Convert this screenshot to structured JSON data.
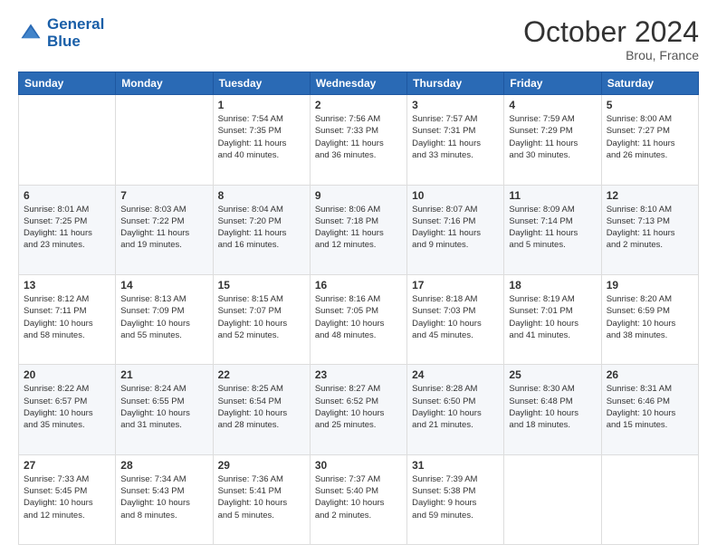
{
  "header": {
    "logo_line1": "General",
    "logo_line2": "Blue",
    "title": "October 2024",
    "location": "Brou, France"
  },
  "weekdays": [
    "Sunday",
    "Monday",
    "Tuesday",
    "Wednesday",
    "Thursday",
    "Friday",
    "Saturday"
  ],
  "weeks": [
    [
      {
        "day": "",
        "info": ""
      },
      {
        "day": "",
        "info": ""
      },
      {
        "day": "1",
        "info": "Sunrise: 7:54 AM\nSunset: 7:35 PM\nDaylight: 11 hours\nand 40 minutes."
      },
      {
        "day": "2",
        "info": "Sunrise: 7:56 AM\nSunset: 7:33 PM\nDaylight: 11 hours\nand 36 minutes."
      },
      {
        "day": "3",
        "info": "Sunrise: 7:57 AM\nSunset: 7:31 PM\nDaylight: 11 hours\nand 33 minutes."
      },
      {
        "day": "4",
        "info": "Sunrise: 7:59 AM\nSunset: 7:29 PM\nDaylight: 11 hours\nand 30 minutes."
      },
      {
        "day": "5",
        "info": "Sunrise: 8:00 AM\nSunset: 7:27 PM\nDaylight: 11 hours\nand 26 minutes."
      }
    ],
    [
      {
        "day": "6",
        "info": "Sunrise: 8:01 AM\nSunset: 7:25 PM\nDaylight: 11 hours\nand 23 minutes."
      },
      {
        "day": "7",
        "info": "Sunrise: 8:03 AM\nSunset: 7:22 PM\nDaylight: 11 hours\nand 19 minutes."
      },
      {
        "day": "8",
        "info": "Sunrise: 8:04 AM\nSunset: 7:20 PM\nDaylight: 11 hours\nand 16 minutes."
      },
      {
        "day": "9",
        "info": "Sunrise: 8:06 AM\nSunset: 7:18 PM\nDaylight: 11 hours\nand 12 minutes."
      },
      {
        "day": "10",
        "info": "Sunrise: 8:07 AM\nSunset: 7:16 PM\nDaylight: 11 hours\nand 9 minutes."
      },
      {
        "day": "11",
        "info": "Sunrise: 8:09 AM\nSunset: 7:14 PM\nDaylight: 11 hours\nand 5 minutes."
      },
      {
        "day": "12",
        "info": "Sunrise: 8:10 AM\nSunset: 7:13 PM\nDaylight: 11 hours\nand 2 minutes."
      }
    ],
    [
      {
        "day": "13",
        "info": "Sunrise: 8:12 AM\nSunset: 7:11 PM\nDaylight: 10 hours\nand 58 minutes."
      },
      {
        "day": "14",
        "info": "Sunrise: 8:13 AM\nSunset: 7:09 PM\nDaylight: 10 hours\nand 55 minutes."
      },
      {
        "day": "15",
        "info": "Sunrise: 8:15 AM\nSunset: 7:07 PM\nDaylight: 10 hours\nand 52 minutes."
      },
      {
        "day": "16",
        "info": "Sunrise: 8:16 AM\nSunset: 7:05 PM\nDaylight: 10 hours\nand 48 minutes."
      },
      {
        "day": "17",
        "info": "Sunrise: 8:18 AM\nSunset: 7:03 PM\nDaylight: 10 hours\nand 45 minutes."
      },
      {
        "day": "18",
        "info": "Sunrise: 8:19 AM\nSunset: 7:01 PM\nDaylight: 10 hours\nand 41 minutes."
      },
      {
        "day": "19",
        "info": "Sunrise: 8:20 AM\nSunset: 6:59 PM\nDaylight: 10 hours\nand 38 minutes."
      }
    ],
    [
      {
        "day": "20",
        "info": "Sunrise: 8:22 AM\nSunset: 6:57 PM\nDaylight: 10 hours\nand 35 minutes."
      },
      {
        "day": "21",
        "info": "Sunrise: 8:24 AM\nSunset: 6:55 PM\nDaylight: 10 hours\nand 31 minutes."
      },
      {
        "day": "22",
        "info": "Sunrise: 8:25 AM\nSunset: 6:54 PM\nDaylight: 10 hours\nand 28 minutes."
      },
      {
        "day": "23",
        "info": "Sunrise: 8:27 AM\nSunset: 6:52 PM\nDaylight: 10 hours\nand 25 minutes."
      },
      {
        "day": "24",
        "info": "Sunrise: 8:28 AM\nSunset: 6:50 PM\nDaylight: 10 hours\nand 21 minutes."
      },
      {
        "day": "25",
        "info": "Sunrise: 8:30 AM\nSunset: 6:48 PM\nDaylight: 10 hours\nand 18 minutes."
      },
      {
        "day": "26",
        "info": "Sunrise: 8:31 AM\nSunset: 6:46 PM\nDaylight: 10 hours\nand 15 minutes."
      }
    ],
    [
      {
        "day": "27",
        "info": "Sunrise: 7:33 AM\nSunset: 5:45 PM\nDaylight: 10 hours\nand 12 minutes."
      },
      {
        "day": "28",
        "info": "Sunrise: 7:34 AM\nSunset: 5:43 PM\nDaylight: 10 hours\nand 8 minutes."
      },
      {
        "day": "29",
        "info": "Sunrise: 7:36 AM\nSunset: 5:41 PM\nDaylight: 10 hours\nand 5 minutes."
      },
      {
        "day": "30",
        "info": "Sunrise: 7:37 AM\nSunset: 5:40 PM\nDaylight: 10 hours\nand 2 minutes."
      },
      {
        "day": "31",
        "info": "Sunrise: 7:39 AM\nSunset: 5:38 PM\nDaylight: 9 hours\nand 59 minutes."
      },
      {
        "day": "",
        "info": ""
      },
      {
        "day": "",
        "info": ""
      }
    ]
  ]
}
